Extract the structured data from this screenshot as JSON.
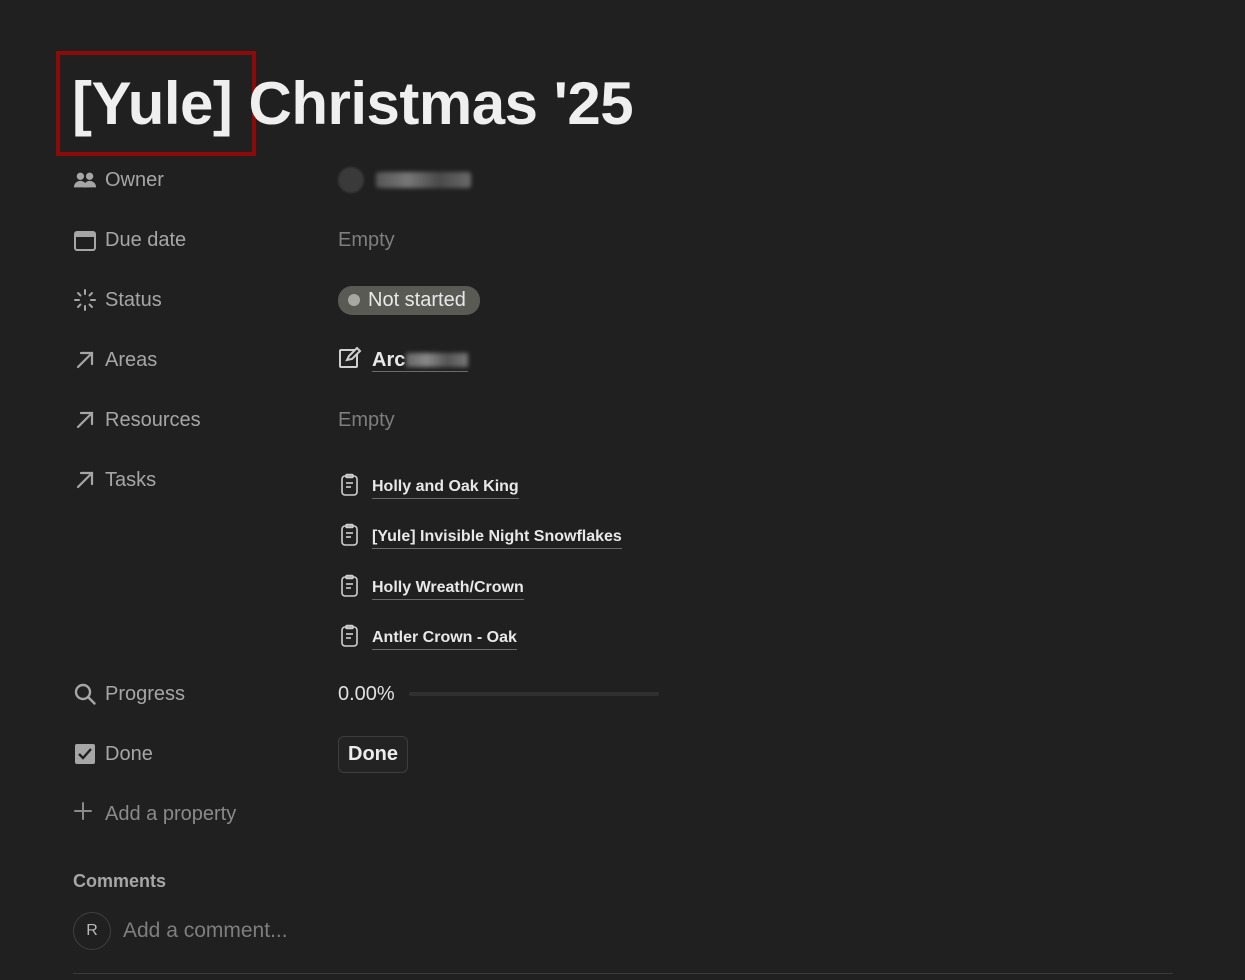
{
  "page": {
    "title": "[Yule] Christmas '25"
  },
  "properties": {
    "owner": {
      "label": "Owner",
      "icon": "people-icon"
    },
    "due_date": {
      "label": "Due date",
      "value": "Empty",
      "icon": "calendar-icon"
    },
    "status": {
      "label": "Status",
      "value": "Not started",
      "icon": "loading-icon"
    },
    "areas": {
      "label": "Areas",
      "value": "Arc",
      "icon": "arrow-up-right-icon"
    },
    "resources": {
      "label": "Resources",
      "value": "Empty",
      "icon": "arrow-up-right-icon"
    },
    "tasks": {
      "label": "Tasks",
      "icon": "arrow-up-right-icon",
      "items": [
        "Holly and Oak King",
        "[Yule] Invisible Night Snowflakes",
        "Holly Wreath/Crown",
        "Antler Crown - Oak"
      ]
    },
    "progress": {
      "label": "Progress",
      "value": "0.00%",
      "fraction": 0.0,
      "icon": "search-icon"
    },
    "done": {
      "label": "Done",
      "button_label": "Done",
      "icon": "checkbox-icon"
    },
    "add_property": {
      "label": "Add a property"
    }
  },
  "comments": {
    "title": "Comments",
    "avatar_initial": "R",
    "placeholder": "Add a comment..."
  },
  "colors": {
    "background": "#202020",
    "highlight_border": "#8b0a0a",
    "status_pill": "#5a5a55"
  }
}
